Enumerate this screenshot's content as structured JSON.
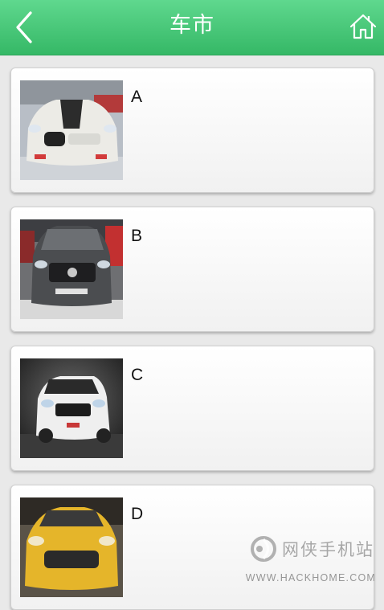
{
  "header": {
    "title": "车市",
    "back_icon": "chevron-left-icon",
    "home_icon": "home-icon",
    "color": "#3fc16f"
  },
  "cars": [
    {
      "label": "A",
      "image": "white-sedan-photo"
    },
    {
      "label": "B",
      "image": "grey-suv-photo"
    },
    {
      "label": "C",
      "image": "white-suv-photo"
    },
    {
      "label": "D",
      "image": "yellow-coupe-photo"
    }
  ],
  "watermark": {
    "brand": "网侠手机站",
    "url": "WWW.HACKHOME.COM"
  }
}
